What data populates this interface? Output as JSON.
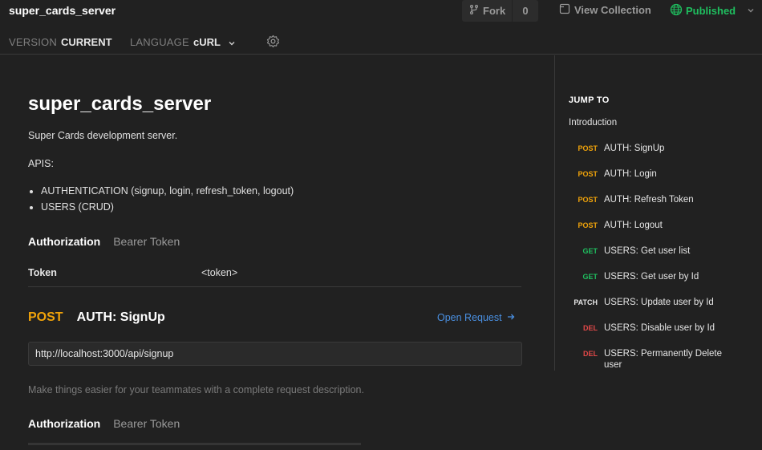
{
  "header": {
    "title": "super_cards_server",
    "fork_label": "Fork",
    "fork_count": "0",
    "view_collection_label": "View Collection",
    "published_label": "Published"
  },
  "toolbar": {
    "version_label": "VERSION",
    "version_value": "CURRENT",
    "language_label": "LANGUAGE",
    "language_value": "cURL"
  },
  "doc": {
    "title": "super_cards_server",
    "description": "Super Cards development server.",
    "apis_label": "APIS:",
    "apis": [
      "AUTHENTICATION (signup, login, refresh_token, logout)",
      "USERS (CRUD)"
    ],
    "authorization_label": "Authorization",
    "authorization_type": "Bearer Token",
    "token_key": "Token",
    "token_value": "<token>"
  },
  "request": {
    "method": "POST",
    "name": "AUTH: SignUp",
    "open_label": "Open Request",
    "url": "http://localhost:3000/api/signup",
    "description_hint": "Make things easier for your teammates with a complete request description.",
    "authorization_label": "Authorization",
    "authorization_type": "Bearer Token"
  },
  "sidebar": {
    "jump_to": "JUMP TO",
    "introduction": "Introduction",
    "items": [
      {
        "method": "POST",
        "label": "AUTH: SignUp"
      },
      {
        "method": "POST",
        "label": "AUTH: Login"
      },
      {
        "method": "POST",
        "label": "AUTH: Refresh Token"
      },
      {
        "method": "POST",
        "label": "AUTH: Logout"
      },
      {
        "method": "GET",
        "label": "USERS: Get user list"
      },
      {
        "method": "GET",
        "label": "USERS: Get user by Id"
      },
      {
        "method": "PATCH",
        "label": "USERS: Update user by Id"
      },
      {
        "method": "DEL",
        "label": "USERS: Disable user by Id"
      },
      {
        "method": "DEL",
        "label": "USERS: Permanently Delete user"
      }
    ]
  },
  "icons": {
    "fork": "fork-icon",
    "collection": "document-icon",
    "published": "globe-icon",
    "settings": "gear-icon"
  },
  "colors": {
    "post": "#f0a30a",
    "get": "#1fbf5f",
    "del": "#e04848",
    "link": "#4a90e2"
  }
}
